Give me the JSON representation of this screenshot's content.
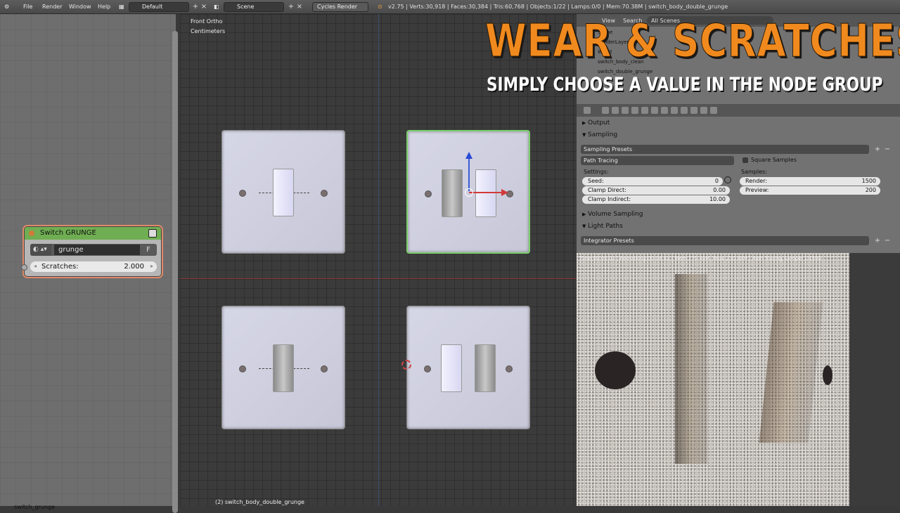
{
  "menu": {
    "file": "File",
    "render": "Render",
    "window": "Window",
    "help": "Help",
    "layout": "Default",
    "scene": "Scene",
    "engine": "Cycles Render",
    "stats": "v2.75 | Verts:30,918 | Faces:30,384 | Tris:60,768 | Objects:1/22 | Lamps:0/0 | Mem:70.38M | switch_body_double_grunge"
  },
  "node": {
    "title": "Switch GRUNGE",
    "group_name": "grunge",
    "fake_user": "F",
    "input_label": "Scratches:",
    "input_value": "2.000",
    "footer": "switch_grunge"
  },
  "viewport": {
    "view": "Front Ortho",
    "units": "Centimeters",
    "footer": "(2) switch_body_double_grunge"
  },
  "overlay": {
    "title": "WEAR & SCRATCHES",
    "subtitle": "SIMPLY CHOOSE A VALUE IN THE NODE GROUP"
  },
  "outliner": {
    "view": "View",
    "search": "Search",
    "all_scenes": "All Scenes",
    "rows": [
      "Scene",
      "RenderLayers",
      "World",
      "switch_body_clean",
      "switch_double_grunge"
    ]
  },
  "properties": {
    "output": "Output",
    "sampling": "Sampling",
    "sampling_presets": "Sampling Presets",
    "integrator": "Path Tracing",
    "square_samples": "Square Samples",
    "settings": "Settings:",
    "samples": "Samples:",
    "seed_label": "Seed:",
    "seed_value": "0",
    "clamp_direct_label": "Clamp Direct:",
    "clamp_direct_value": "0.00",
    "clamp_indirect_label": "Clamp Indirect:",
    "clamp_indirect_value": "10.00",
    "render_label": "Render:",
    "render_value": "1500",
    "preview_label": "Preview:",
    "preview_value": "200",
    "volume_sampling": "Volume Sampling",
    "light_paths": "Light Paths",
    "integrator_presets": "Integrator Presets"
  },
  "render_status": "Time:00:00.02 | Remaining:00:04.42 | Mem:270.40M, Peak:270.48M | Path Tracing Sample 1/1500"
}
